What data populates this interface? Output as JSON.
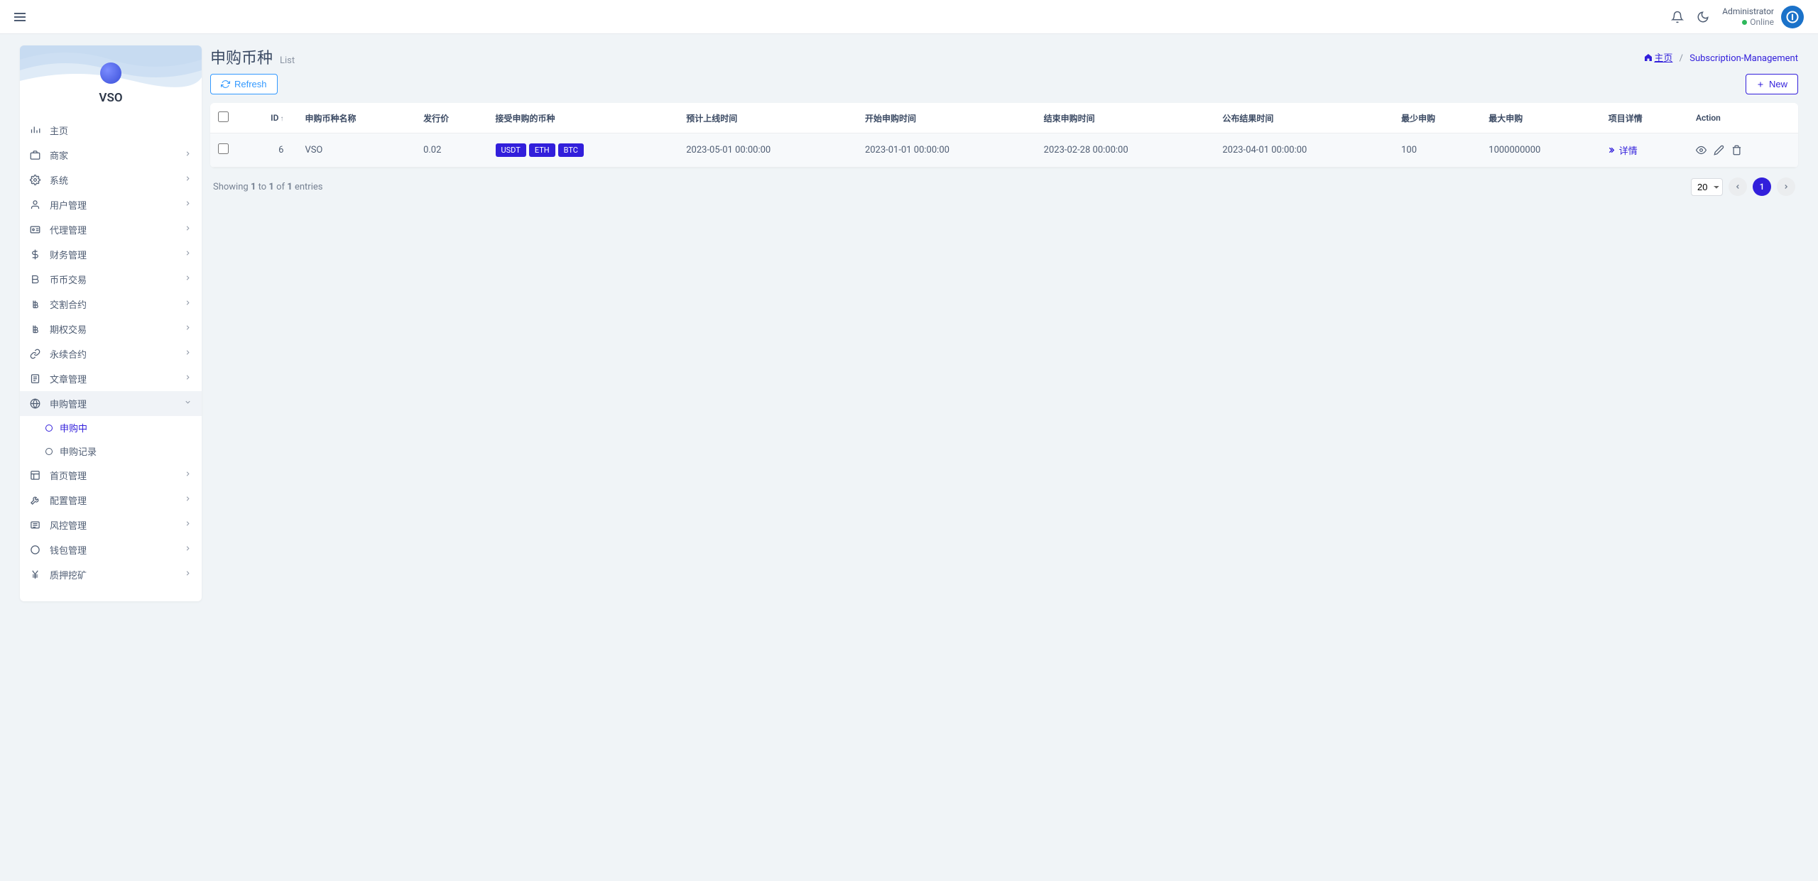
{
  "header": {
    "user_name": "Administrator",
    "user_status": "Online"
  },
  "brand": {
    "name": "VSO"
  },
  "sidebar": {
    "items": [
      {
        "label": "主页",
        "icon": "bars"
      },
      {
        "label": "商家",
        "icon": "briefcase"
      },
      {
        "label": "系统",
        "icon": "gear"
      },
      {
        "label": "用户管理",
        "icon": "user"
      },
      {
        "label": "代理管理",
        "icon": "idcard"
      },
      {
        "label": "财务管理",
        "icon": "dollar"
      },
      {
        "label": "币币交易",
        "icon": "bold"
      },
      {
        "label": "交割合约",
        "icon": "bitcoin"
      },
      {
        "label": "期权交易",
        "icon": "bitcoin"
      },
      {
        "label": "永续合约",
        "icon": "link"
      },
      {
        "label": "文章管理",
        "icon": "doc"
      },
      {
        "label": "申购管理",
        "icon": "globe",
        "expanded": true,
        "children": [
          {
            "label": "申购中",
            "active": true
          },
          {
            "label": "申购记录"
          }
        ]
      },
      {
        "label": "首页管理",
        "icon": "layout"
      },
      {
        "label": "配置管理",
        "icon": "wrench"
      },
      {
        "label": "风控管理",
        "icon": "shield"
      },
      {
        "label": "钱包管理",
        "icon": "circle"
      },
      {
        "label": "质押挖矿",
        "icon": "yen"
      }
    ]
  },
  "page": {
    "title": "申购币种",
    "subtitle": "List",
    "breadcrumb_home": "主页",
    "breadcrumb_current": "Subscription-Management"
  },
  "toolbar": {
    "refresh_label": "Refresh",
    "new_label": "New"
  },
  "table": {
    "columns": {
      "id": "ID",
      "name": "申购币种名称",
      "price": "发行价",
      "accept": "接受申购的币种",
      "online_time": "预计上线时间",
      "start_time": "开始申购时间",
      "end_time": "结束申购时间",
      "result_time": "公布结果时间",
      "min": "最少申购",
      "max": "最大申购",
      "detail": "项目详情",
      "action": "Action"
    },
    "rows": [
      {
        "id": "6",
        "name": "VSO",
        "price": "0.02",
        "accept": [
          "USDT",
          "ETH",
          "BTC"
        ],
        "online_time": "2023-05-01 00:00:00",
        "start_time": "2023-01-01 00:00:00",
        "end_time": "2023-02-28 00:00:00",
        "result_time": "2023-04-01 00:00:00",
        "min": "100",
        "max": "1000000000",
        "detail_label": "详情"
      }
    ]
  },
  "footer": {
    "showing_prefix": "Showing ",
    "from": "1",
    "to_word": " to ",
    "to": "1",
    "of_word": " of ",
    "total": "1",
    "entries_word": " entries",
    "page_size_selected": "20",
    "current_page": "1"
  }
}
